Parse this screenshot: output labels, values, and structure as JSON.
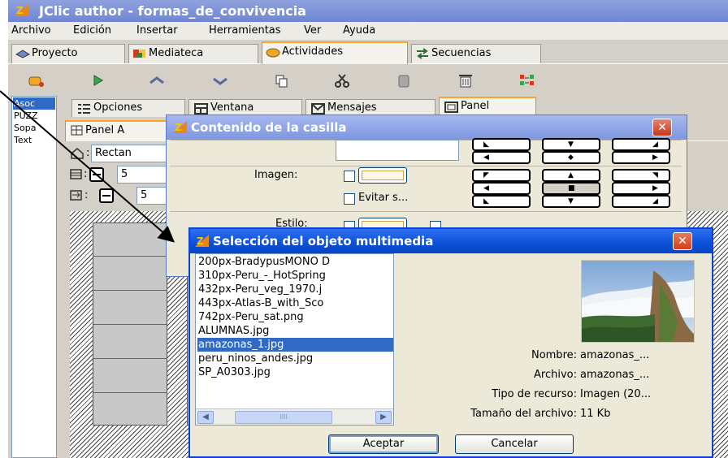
{
  "main_window": {
    "title": "JClic author - formas_de_convivencia"
  },
  "menu": [
    "Archivo",
    "Edición",
    "Insertar",
    "Herramientas",
    "Ver",
    "Ayuda"
  ],
  "main_tabs": [
    {
      "label": "Proyecto",
      "icon": "project-icon"
    },
    {
      "label": "Mediateca",
      "icon": "media-library-icon"
    },
    {
      "label": "Actividades",
      "icon": "activities-icon",
      "active": true
    },
    {
      "label": "Secuencias",
      "icon": "sequences-icon"
    }
  ],
  "toolbar": [
    "new-activity-icon",
    "play-icon",
    "move-up-icon",
    "move-down-icon",
    "copy-icon",
    "cut-icon",
    "paste-icon",
    "delete-icon",
    "convert-icon"
  ],
  "activities": [
    "Asoc",
    "PUZZ",
    "Sopa",
    "Text"
  ],
  "activity_tabs": [
    {
      "label": "Opciones",
      "icon": "options-icon"
    },
    {
      "label": "Ventana",
      "icon": "window-icon"
    },
    {
      "label": "Mensajes",
      "icon": "messages-icon"
    },
    {
      "label": "Panel",
      "icon": "panel-icon",
      "active": true
    }
  ],
  "panel_tab": {
    "label": "Panel A"
  },
  "props": {
    "shape": "Rectan",
    "rows": "5",
    "cols": "5"
  },
  "cell_dialog": {
    "title": "Contenido de la casilla",
    "image_label": "Imagen:",
    "avoid_label": "Evitar s...",
    "style_label": "Estilo:"
  },
  "media_dialog": {
    "title": "Selección del objeto multimedia",
    "files": [
      "200px-BradypusMONO D",
      "310px-Peru_-_HotSpring",
      "432px-Peru_veg_1970.j",
      "443px-Atlas-B_with_Sco",
      "742px-Peru_sat.png",
      "ALUMNAS.jpg",
      "amazonas_1.jpg",
      "peru_ninos_andes.jpg",
      "SP_A0303.jpg"
    ],
    "selected_index": 6,
    "info": [
      {
        "key": "Nombre:",
        "value": "amazonas_..."
      },
      {
        "key": "Archivo:",
        "value": "amazonas_..."
      },
      {
        "key": "Tipo de recurso:",
        "value": "Imagen (20..."
      },
      {
        "key": "Tamaño del archivo:",
        "value": "11 Kb"
      }
    ],
    "ok_label": "Aceptar",
    "cancel_label": "Cancelar",
    "scroll_thumb": "IIII"
  },
  "colors": {
    "title_active": "#0a50d8",
    "title_inactive": "#7e96df",
    "selection": "#316ac5",
    "tab_accent": "#f9a62b",
    "close_red": "#c4381d"
  }
}
